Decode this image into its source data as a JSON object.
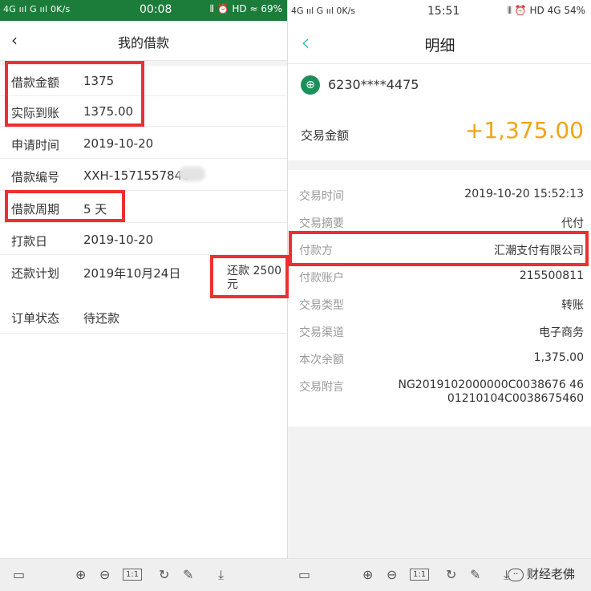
{
  "left": {
    "status_bar": {
      "signal": "4G ııl G ııl 0K/s",
      "time": "00:08",
      "right": "⫴ ⏰ HD ≈ 69%"
    },
    "nav": {
      "back_icon": "‹",
      "title": "我的借款"
    },
    "rows": [
      {
        "label": "借款金额",
        "value": "1375"
      },
      {
        "label": "实际到账",
        "value": "1375.00"
      },
      {
        "label": "申请时间",
        "value": "2019-10-20"
      },
      {
        "label": "借款编号",
        "value": "XXH-1571557846"
      },
      {
        "label": "借款周期",
        "value": "5 天"
      },
      {
        "label": "打款日",
        "value": "2019-10-20"
      },
      {
        "label": "还款计划",
        "value": "2019年10月24日"
      },
      {
        "label": "订单状态",
        "value": "待还款"
      }
    ],
    "repay_note": "还款 2500 元"
  },
  "right": {
    "status_bar": {
      "signal": "4G ııl G ııl 0K/s",
      "time": "15:51",
      "right": "⫴ ⏰ HD 4G 54%"
    },
    "nav": {
      "back_icon": "‹",
      "title": "明细"
    },
    "account": "6230****4475",
    "amount_label": "交易金额",
    "amount_value": "+1,375.00",
    "details": [
      {
        "label": "交易时间",
        "value": "2019-10-20 15:52:13"
      },
      {
        "label": "交易摘要",
        "value": "代付"
      },
      {
        "label": "付款方",
        "value": "汇潮支付有限公司"
      },
      {
        "label": "付款账户",
        "value": "215500811"
      },
      {
        "label": "交易类型",
        "value": "转账"
      },
      {
        "label": "交易渠道",
        "value": "电子商务"
      },
      {
        "label": "本次余额",
        "value": "1,375.00"
      },
      {
        "label": "交易附言",
        "value": "NG2019102000000C0038676 46 01210104C0038675460"
      }
    ]
  },
  "toolbar": {
    "icons": [
      "sidebar-icon",
      "zoom-in-icon",
      "zoom-out-icon",
      "actual-size-icon",
      "rotate-icon",
      "pen-icon",
      "download-icon"
    ],
    "actual_size_label": "1:1",
    "watermark": "财经老佛"
  },
  "colors": {
    "green_status": "#1c7c3a",
    "accent_orange": "#f0a416",
    "teal_back": "#2bb59f",
    "highlight_red": "#ee2f2f"
  }
}
